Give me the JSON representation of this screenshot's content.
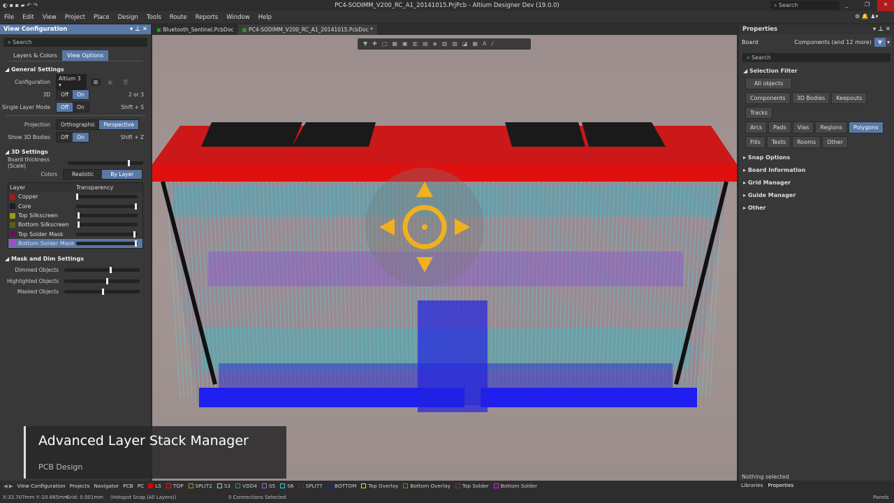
{
  "app": {
    "title": "PC4-SODIMM_V200_RC_A1_20141015.PrjPcb - Altium Designer Dev (19.0.0)",
    "search": "Search"
  },
  "menu": [
    "File",
    "Edit",
    "View",
    "Project",
    "Place",
    "Design",
    "Tools",
    "Route",
    "Reports",
    "Window",
    "Help"
  ],
  "doc_tabs": [
    "Bluetooth_Sentinel.PcbDoc",
    "PC4-SODIMM_V200_RC_A1_20141015.PcbDoc *"
  ],
  "view_config": {
    "title": "View Configuration",
    "search": "Search",
    "tabs": [
      "Layers & Colors",
      "View Options"
    ],
    "general": {
      "title": "General Settings",
      "configuration_label": "Configuration",
      "configuration_value": "Altium 3",
      "three_d_label": "3D",
      "three_d_hint": "2 or 3",
      "single_layer_label": "Single Layer Mode",
      "single_layer_hint": "Shift + S",
      "projection_label": "Projection",
      "projection_options": [
        "Orthographic",
        "Perspective"
      ],
      "show_bodies_label": "Show 3D Bodies",
      "show_bodies_hint": "Shift + Z",
      "off": "Off",
      "on": "On"
    },
    "three_d": {
      "title": "3D Settings",
      "board_thickness_label": "Board thickness (Scale)",
      "board_thickness": 0.8,
      "colors_label": "Colors",
      "colors_options": [
        "Realistic",
        "By Layer"
      ],
      "col_layer": "Layer",
      "col_transparency": "Transparency",
      "layers": [
        {
          "name": "Copper",
          "color": "#a11c1c",
          "t": 0.0
        },
        {
          "name": "Core",
          "color": "#1e1e1e",
          "t": 1.0
        },
        {
          "name": "Top Silkscreen",
          "color": "#9a9a20",
          "t": 0.02
        },
        {
          "name": "Bottom Silkscreen",
          "color": "#5c5c1e",
          "t": 0.02
        },
        {
          "name": "Top Solder Mask",
          "color": "#5a1a5a",
          "t": 0.97
        },
        {
          "name": "Bottom Solder Mask",
          "color": "#b045c8",
          "t": 1.0
        }
      ]
    },
    "mask": {
      "title": "Mask and Dim Settings",
      "items": [
        {
          "name": "Dimmed Objects",
          "v": 0.6
        },
        {
          "name": "Highlighted Objects",
          "v": 0.56
        },
        {
          "name": "Masked Objects",
          "v": 0.5
        }
      ]
    }
  },
  "properties": {
    "title": "Properties",
    "board": "Board",
    "filter_summary": "Components (and 12 more)",
    "search": "Search",
    "selection_filter": "Selection Filter",
    "all_objects": "All objects",
    "filters": [
      [
        "Components",
        "3D Bodies",
        "Keepouts",
        "Tracks"
      ],
      [
        "Arcs",
        "Pads",
        "Vias",
        "Regions",
        "Polygons"
      ],
      [
        "Fills",
        "Texts",
        "Rooms",
        "Other"
      ]
    ],
    "active_filter": "Polygons",
    "sections": [
      "Snap Options",
      "Board Information",
      "Grid Manager",
      "Guide Manager",
      "Other"
    ],
    "nothing_selected": "Nothing selected",
    "bottom_tabs": [
      "Libraries",
      "Properties"
    ]
  },
  "bottom_tabs": [
    "View Configuration",
    "Projects",
    "Navigator",
    "PCB",
    "PC"
  ],
  "layer_tabs": [
    {
      "n": "LS",
      "c": "#e00000"
    },
    {
      "n": "TOP",
      "c": "#e02020"
    },
    {
      "n": "SPLIT2",
      "c": "#b09020"
    },
    {
      "n": "S3",
      "c": "#8cc8e0"
    },
    {
      "n": "VDD4",
      "c": "#20a060"
    },
    {
      "n": "S5",
      "c": "#9070e0"
    },
    {
      "n": "S6",
      "c": "#30d0d0"
    },
    {
      "n": "SPLIT7",
      "c": "#801080"
    },
    {
      "n": "BOTTOM",
      "c": "#2020d0"
    },
    {
      "n": "Top Overlay",
      "c": "#e0e020"
    },
    {
      "n": "Bottom Overlay",
      "c": "#808020"
    },
    {
      "n": "Top Solder",
      "c": "#802080"
    },
    {
      "n": "Bottom Solder",
      "c": "#e020e0"
    }
  ],
  "status": {
    "coords": "X:32.707mm Y:-20.665mm",
    "grid": "Grid: 0.001mm",
    "snap": "(Hotspot Snap (All Layers))",
    "connections": "0 Connections Selected",
    "panels": "Panels"
  },
  "overlay": {
    "title": "Advanced Layer Stack Manager",
    "subtitle": "PCB Design"
  }
}
